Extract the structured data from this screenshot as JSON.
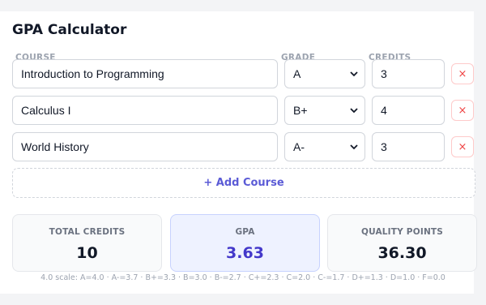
{
  "title": "GPA Calculator",
  "columns": {
    "course": "COURSE",
    "grade": "GRADE",
    "credits": "CREDITS"
  },
  "rows": [
    {
      "course": "Introduction to Programming",
      "grade": "A",
      "credits": "3",
      "remove_label": "×"
    },
    {
      "course": "Calculus I",
      "grade": "B+",
      "credits": "4",
      "remove_label": "×"
    },
    {
      "course": "World History",
      "grade": "A-",
      "credits": "3",
      "remove_label": "×"
    }
  ],
  "add_course_label": "+ Add Course",
  "stats": {
    "total_credits": {
      "label": "TOTAL CREDITS",
      "value": "10"
    },
    "gpa": {
      "label": "GPA",
      "value": "3.63"
    },
    "quality_points": {
      "label": "QUALITY POINTS",
      "value": "36.30"
    }
  },
  "scale_note": "4.0 scale: A=4.0 · A-=3.7 · B+=3.3 · B=3.0 · B-=2.7 · C+=2.3 · C=2.0 · C-=1.7 · D+=1.3 · D=1.0 · F=0.0",
  "colors": {
    "accent": "#5b5bd6",
    "gpa_value": "#4338ca",
    "remove": "#ef4444"
  }
}
